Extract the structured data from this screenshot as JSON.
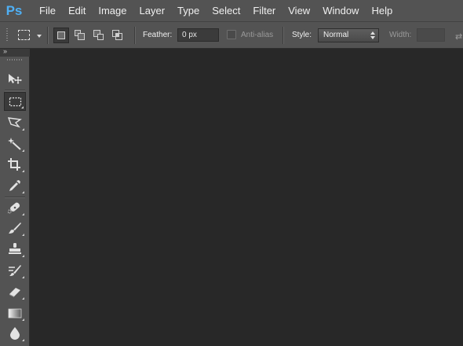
{
  "app": {
    "logo": "Ps"
  },
  "menu": [
    "File",
    "Edit",
    "Image",
    "Layer",
    "Type",
    "Select",
    "Filter",
    "View",
    "Window",
    "Help"
  ],
  "options": {
    "feather_label": "Feather:",
    "feather_value": "0 px",
    "antialias_label": "Anti-alias",
    "style_label": "Style:",
    "style_value": "Normal",
    "width_label": "Width:",
    "width_value": ""
  },
  "toolbar": {
    "tools": [
      {
        "name": "move-tool-icon"
      },
      {
        "name": "rectangular-marquee-tool-icon",
        "active": true
      },
      {
        "name": "lasso-tool-icon"
      },
      {
        "name": "magic-wand-tool-icon"
      },
      {
        "name": "crop-tool-icon"
      },
      {
        "name": "eyedropper-tool-icon"
      },
      {
        "name": "spot-healing-brush-tool-icon"
      },
      {
        "name": "brush-tool-icon"
      },
      {
        "name": "clone-stamp-tool-icon"
      },
      {
        "name": "history-brush-tool-icon"
      },
      {
        "name": "eraser-tool-icon"
      },
      {
        "name": "gradient-tool-icon"
      },
      {
        "name": "blur-tool-icon"
      }
    ]
  },
  "colors": {
    "logo": "#4fb0f5",
    "chrome": "#535353",
    "canvas": "#282828"
  }
}
